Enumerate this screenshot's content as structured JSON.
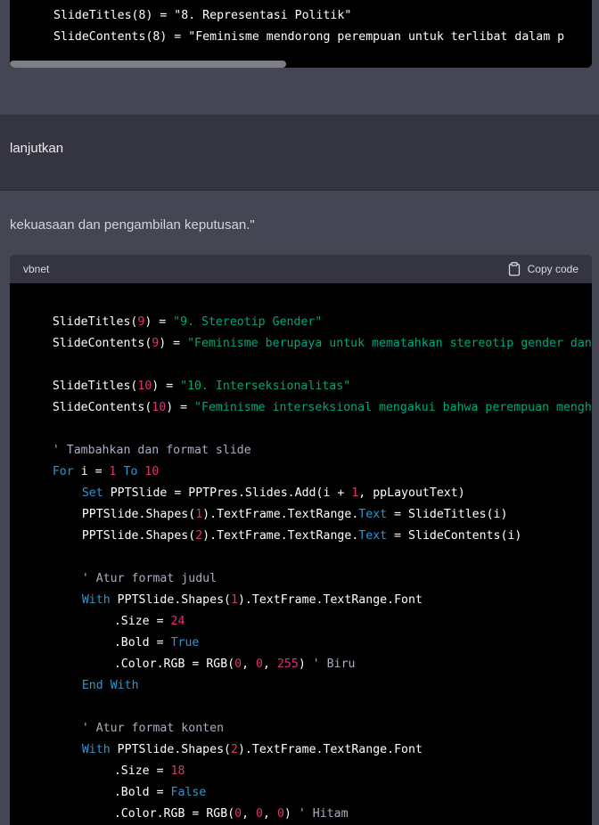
{
  "top_code": {
    "lines": [
      "SlideTitles(8) = \"8. Representasi Politik\"",
      "SlideContents(8) = \"Feminisme mendorong perempuan untuk terlibat dalam p"
    ]
  },
  "user_message": {
    "text": "lanjutkan"
  },
  "assistant_message": {
    "text": "kekuasaan dan pengambilan keputusan.\""
  },
  "code_block": {
    "language": "vbnet",
    "copy_label": "Copy code",
    "tokens": {
      "l1": [
        "SlideTitles(",
        "9",
        ") = ",
        "\"9. Stereotip Gender\""
      ],
      "l2": [
        "SlideContents(",
        "9",
        ") = ",
        "\"Feminisme berupaya untuk mematahkan stereotip gender dan"
      ],
      "l4": [
        "SlideTitles(",
        "10",
        ") = ",
        "\"10. Interseksionalitas\""
      ],
      "l5": [
        "SlideContents(",
        "10",
        ") = ",
        "\"Feminisme interseksional mengakui bahwa perempuan mengh"
      ],
      "l7": [
        "' Tambahkan dan format slide"
      ],
      "l8": [
        "For",
        " i = ",
        "1",
        " ",
        "To",
        " ",
        "10"
      ],
      "l9": [
        "Set",
        " PPTSlide = PPTPres.Slides.Add(i + ",
        "1",
        ", ppLayoutText)"
      ],
      "l10": [
        "PPTSlide.Shapes(",
        "1",
        ").TextFrame.TextRange.",
        "Text",
        " = SlideTitles(i)"
      ],
      "l11": [
        "PPTSlide.Shapes(",
        "2",
        ").TextFrame.TextRange.",
        "Text",
        " = SlideContents(i)"
      ],
      "l13": [
        "' Atur format judul"
      ],
      "l14": [
        "With",
        " PPTSlide.Shapes(",
        "1",
        ").TextFrame.TextRange.Font"
      ],
      "l15": [
        ".Size = ",
        "24"
      ],
      "l16": [
        ".Bold = ",
        "True"
      ],
      "l17": [
        ".Color.RGB = RGB(",
        "0",
        ", ",
        "0",
        ", ",
        "255",
        ") ",
        "' Biru"
      ],
      "l18": [
        "End",
        " ",
        "With"
      ],
      "l20": [
        "' Atur format konten"
      ],
      "l21": [
        "With",
        " PPTSlide.Shapes(",
        "2",
        ").TextFrame.TextRange.Font"
      ],
      "l22": [
        ".Size = ",
        "18"
      ],
      "l23": [
        ".Bold = ",
        "False"
      ],
      "l24": [
        ".Color.RGB = RGB(",
        "0",
        ", ",
        "0",
        ", ",
        "0",
        ") ",
        "' Hitam"
      ]
    }
  },
  "colors": {
    "background": "#444654",
    "user_row": "#343541",
    "code_bg": "#000000",
    "string": "#00a67d",
    "number": "#df3079",
    "keyword": "#2e95d3",
    "comment": "#a9aec1"
  },
  "icons": {
    "copy": "clipboard-icon"
  }
}
